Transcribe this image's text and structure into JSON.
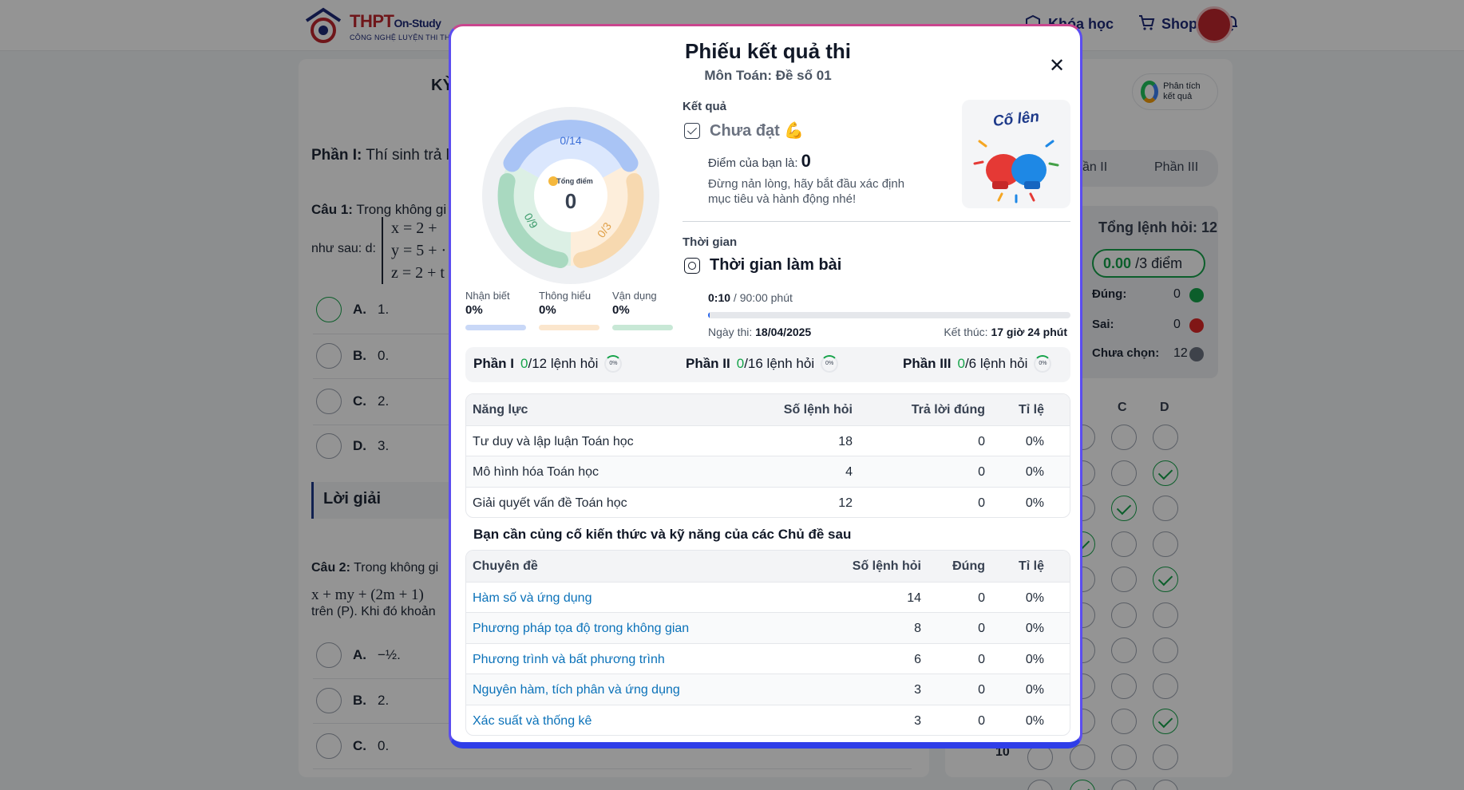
{
  "brand": {
    "name_main": "THPT",
    "name_tail": "On-Study",
    "tagline": "CÔNG NGHỆ LUYỆN THI THPT"
  },
  "topnav": {
    "courses": "Khóa học",
    "shop": "Shop"
  },
  "background": {
    "title_fragment": "KỲ",
    "part1_label": "Phần I:",
    "part1_text": "Thí sinh trả lời",
    "q1_label": "Câu 1:",
    "q1_text": "Trong không gi",
    "q1_line2": "như sau: d:",
    "q1_system": [
      "x = 2 +",
      "y = 5 + ·",
      "z = 2 + t"
    ],
    "options_q1": [
      {
        "key": "A.",
        "text": "1."
      },
      {
        "key": "B.",
        "text": "0."
      },
      {
        "key": "C.",
        "text": "2."
      },
      {
        "key": "D.",
        "text": "3."
      }
    ],
    "solution_label": "Lời giải",
    "q2_label": "Câu 2:",
    "q2_text": "Trong không gi",
    "q2_formula": "x + my + (2m + 1)",
    "q2_line3": "trên (P). Khi đó khoản",
    "options_q2": [
      {
        "key": "A.",
        "text": "−½."
      },
      {
        "key": "B.",
        "text": "2."
      },
      {
        "key": "C.",
        "text": "0."
      }
    ],
    "side": {
      "analyze_label": "Phân tích kết quả",
      "tabs": [
        "ần II",
        "Phần III"
      ],
      "total_questions": "Tổng lệnh hỏi: 12",
      "score_value": "0.00",
      "score_total": "/3 điểm",
      "stats": [
        {
          "label": "Đúng:",
          "value": "0",
          "color": "#16a34a"
        },
        {
          "label": "Sai:",
          "value": "0",
          "color": "#dc2626"
        },
        {
          "label": "Chưa chọn:",
          "value": "12",
          "color": "#6b7280"
        }
      ],
      "grid_headers": [
        "C",
        "D"
      ],
      "grid_last_row_number": "10"
    }
  },
  "modal": {
    "title": "Phiếu kết quả thi",
    "subtitle": "Môn Toán: Đề số 01",
    "donut": {
      "center_label": "Tổng điểm",
      "center_value": "0",
      "segments": [
        {
          "name": "Nhận biết",
          "label": "0/14",
          "color": "#a9c4f5",
          "fill": "#dbe7fd"
        },
        {
          "name": "Thông hiểu",
          "label": "0/3",
          "color": "#f7d9b0",
          "fill": "#fdeedb"
        },
        {
          "name": "Vận dụng",
          "label": "0/9",
          "color": "#a9d9c0",
          "fill": "#dcf0e5"
        }
      ]
    },
    "legend": [
      {
        "name": "Nhận biết",
        "value": "0%",
        "color": "#c9d8f7"
      },
      {
        "name": "Thông hiểu",
        "value": "0%",
        "color": "#fbe6cd"
      },
      {
        "name": "Vận dụng",
        "value": "0%",
        "color": "#c8e8d6"
      }
    ],
    "result": {
      "section_label": "Kết quả",
      "status": "Chưa đạt 💪",
      "score_label": "Điểm của bạn là:",
      "score_value": "0",
      "encourage": "Đừng nản lòng, hãy bắt đầu xác định mục tiêu và hành động nhé!",
      "cheer_text": "Cố lên"
    },
    "time": {
      "section_label": "Thời gian",
      "title": "Thời gian làm bài",
      "used": "0:10",
      "limit": " / 90:00 phút",
      "progress_fraction": 0.002,
      "date_label": "Ngày thi: ",
      "date_value": "18/04/2025",
      "end_label": "Kết thúc: ",
      "end_value": "17 giờ 24 phút"
    },
    "parts": [
      {
        "name": "Phần I",
        "correct": "0",
        "total": "/12 lệnh hỏi",
        "pct": "0%"
      },
      {
        "name": "Phần II",
        "correct": "0",
        "total": "/16 lệnh hỏi",
        "pct": "0%"
      },
      {
        "name": "Phần III",
        "correct": "0",
        "total": "/6 lệnh hỏi",
        "pct": "0%"
      }
    ],
    "competency_table": {
      "headers": [
        "Năng lực",
        "Số lệnh hỏi",
        "Trả lời đúng",
        "Tỉ lệ"
      ],
      "rows": [
        [
          "Tư duy và lập luận Toán học",
          "18",
          "0",
          "0%"
        ],
        [
          "Mô hình hóa Toán học",
          "4",
          "0",
          "0%"
        ],
        [
          "Giải quyết vấn đề Toán học",
          "12",
          "0",
          "0%"
        ]
      ]
    },
    "topics_note": "Bạn cần củng cố kiến thức và kỹ năng của các Chủ đề sau",
    "topics_table": {
      "headers": [
        "Chuyên đề",
        "Số lệnh hỏi",
        "Đúng",
        "Tỉ lệ"
      ],
      "rows": [
        [
          "Hàm số và ứng dụng",
          "14",
          "0",
          "0%"
        ],
        [
          "Phương pháp tọa độ trong không gian",
          "8",
          "0",
          "0%"
        ],
        [
          "Phương trình và bất phương trình",
          "6",
          "0",
          "0%"
        ],
        [
          "Nguyên hàm, tích phân và ứng dụng",
          "3",
          "0",
          "0%"
        ],
        [
          "Xác suất và thống kê",
          "3",
          "0",
          "0%"
        ]
      ]
    }
  }
}
